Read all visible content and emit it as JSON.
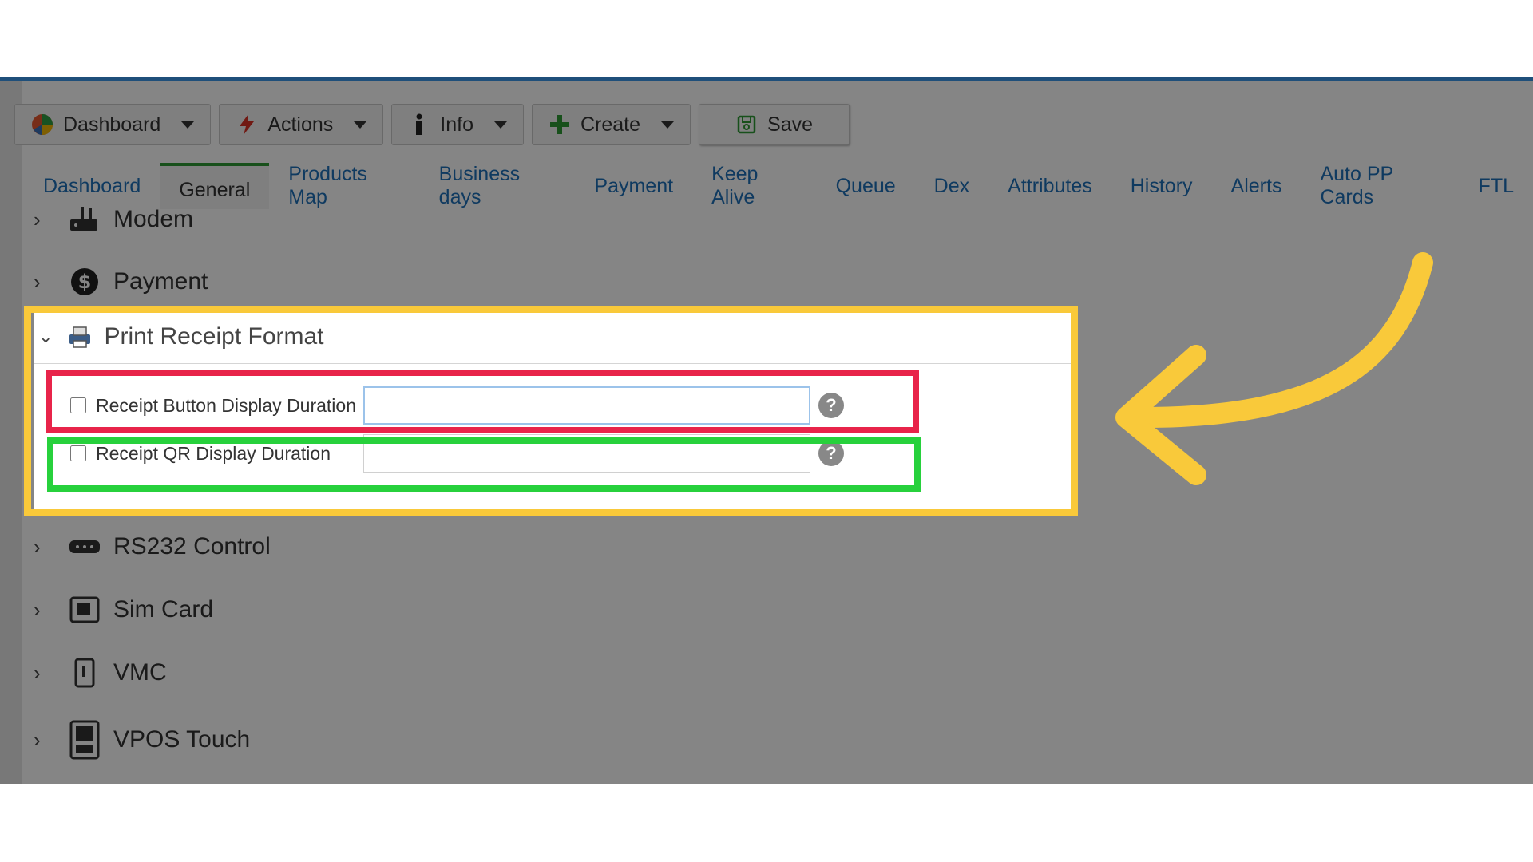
{
  "toolbar": {
    "dashboard_label": "Dashboard",
    "actions_label": "Actions",
    "info_label": "Info",
    "create_label": "Create",
    "save_label": "Save"
  },
  "tabs": [
    {
      "label": "Dashboard"
    },
    {
      "label": "General",
      "active": true
    },
    {
      "label": "Products Map"
    },
    {
      "label": "Business days"
    },
    {
      "label": "Payment"
    },
    {
      "label": "Keep Alive"
    },
    {
      "label": "Queue"
    },
    {
      "label": "Dex"
    },
    {
      "label": "Attributes"
    },
    {
      "label": "History"
    },
    {
      "label": "Alerts"
    },
    {
      "label": "Auto PP Cards"
    },
    {
      "label": "FTL"
    }
  ],
  "sections": {
    "modem": "Modem",
    "payment": "Payment",
    "print_receipt_format": "Print Receipt Format",
    "rs232": "RS232 Control",
    "sim_card": "Sim Card",
    "vmc": "VMC",
    "vpos_touch": "VPOS Touch"
  },
  "fields": {
    "receipt_button": {
      "label": "Receipt Button Display Duration",
      "value": ""
    },
    "receipt_qr": {
      "label": "Receipt QR Display Duration",
      "value": ""
    }
  },
  "colors": {
    "accent_tab": "#2e9a34",
    "link": "#1d6fb8",
    "annotation_yellow": "#f9c93a",
    "annotation_red": "#e8244a",
    "annotation_green": "#27d13c"
  }
}
